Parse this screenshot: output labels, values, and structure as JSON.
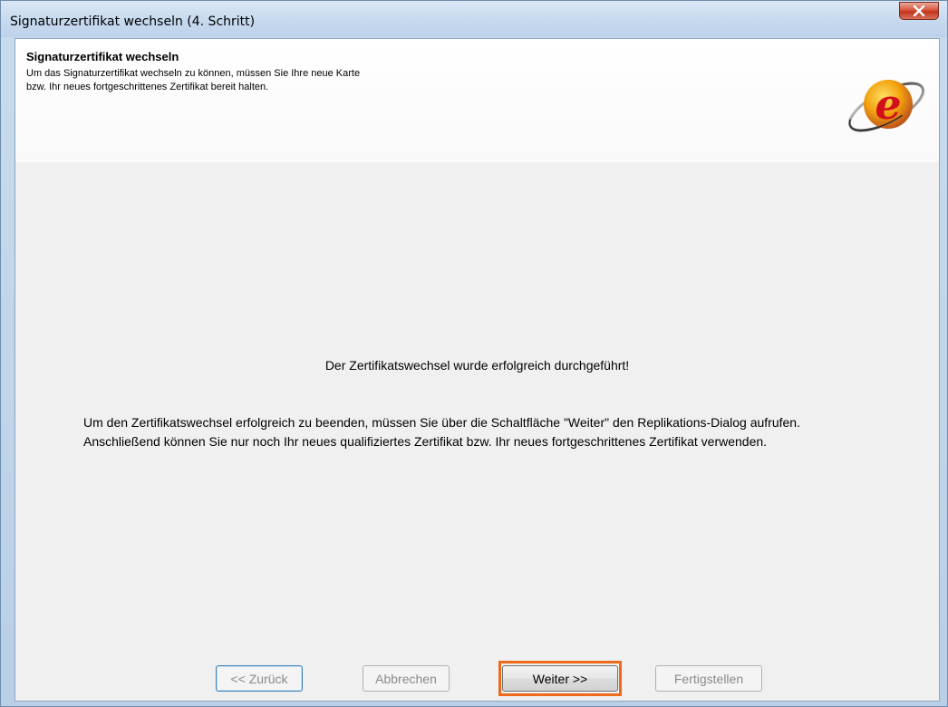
{
  "window": {
    "title": "Signaturzertifikat wechseln (4. Schritt)"
  },
  "header": {
    "title": "Signaturzertifikat wechseln",
    "description_lines": [
      "Um das Signaturzertifikat wechseln zu können, müssen Sie Ihre neue Karte",
      "bzw. Ihr neues fortgeschrittenes Zertifikat bereit halten."
    ],
    "logo_icon": "e-card-logo-icon",
    "logo_letter": "e"
  },
  "content": {
    "status": "Der Zertifikatswechsel wurde erfolgreich durchgeführt!",
    "instruction_lines": [
      "Um den Zertifikatswechsel erfolgreich zu beenden, müssen Sie über die Schaltfläche \"Weiter\" den Replikations-Dialog aufrufen.",
      "Anschließend können Sie nur noch Ihr neues qualifiziertes Zertifikat bzw. Ihr neues fortgeschrittenes Zertifikat verwenden."
    ]
  },
  "buttons": {
    "back": "<< Zurück",
    "cancel": "Abbrechen",
    "next": "Weiter >>",
    "finish": "Fertigstellen"
  },
  "colors": {
    "highlight": "#ed6a1a",
    "close_button": "#c2341c"
  }
}
